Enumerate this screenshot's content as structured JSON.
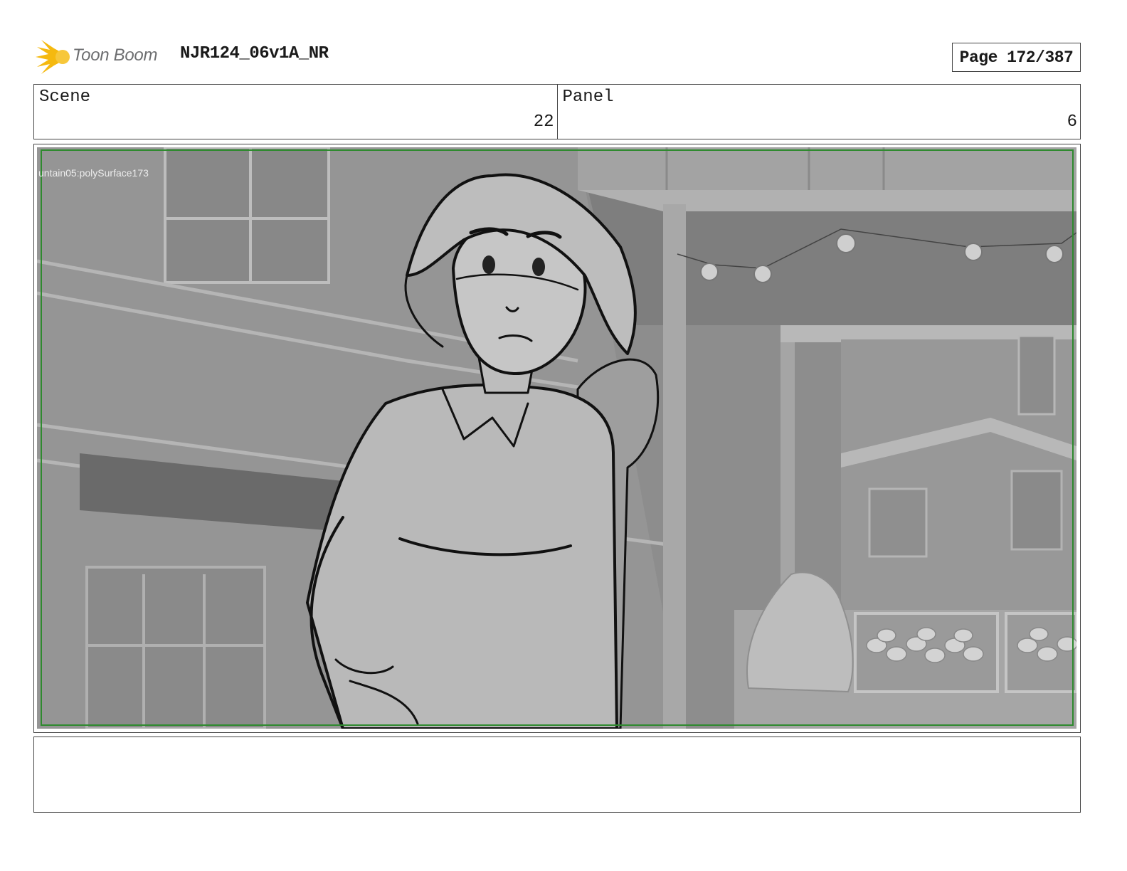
{
  "header": {
    "logo_text": "Toon Boom",
    "project_title": "NJR124_06v1A_NR",
    "page_label": "Page 172/387"
  },
  "info": {
    "scene_label": "Scene",
    "scene_value": "22",
    "panel_label": "Panel",
    "panel_value": "6"
  },
  "panel": {
    "layer_label": "untain05:polySurface173",
    "safe_frame_color": "#2f8a2f"
  },
  "notes": {
    "text": ""
  },
  "colors": {
    "logo_star": "#f5b90f",
    "logo_text": "#6d6e70",
    "border": "#444444"
  }
}
